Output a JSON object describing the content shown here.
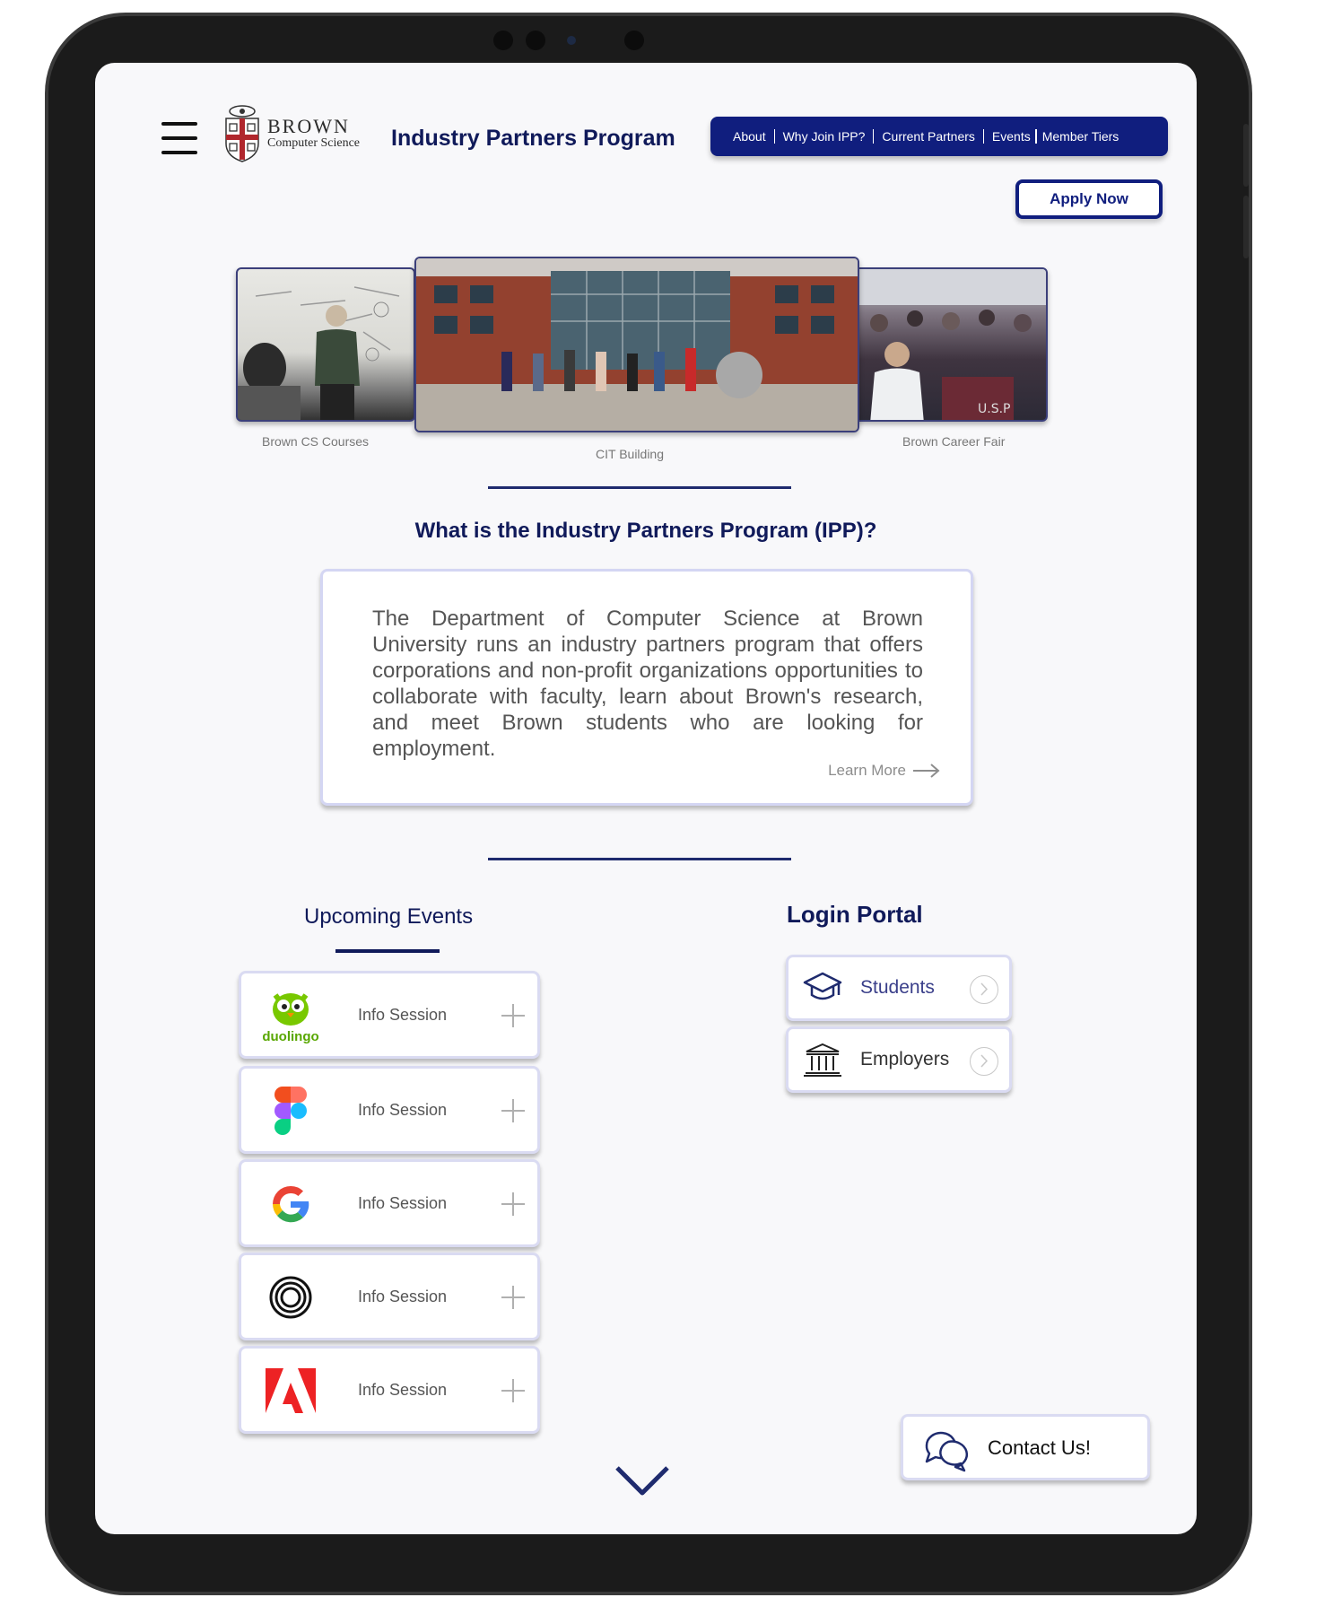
{
  "header": {
    "logo_primary": "BROWN",
    "logo_secondary": "Computer Science",
    "title": "Industry Partners Program"
  },
  "nav": {
    "items": [
      "About",
      "Why Join IPP?",
      "Current Partners",
      "Events",
      "Member Tiers"
    ]
  },
  "apply_label": "Apply Now",
  "carousel": {
    "captions": [
      "Brown CS Courses",
      "CIT Building",
      "Brown Career Fair"
    ]
  },
  "intro": {
    "question": "What is the Industry Partners Program (IPP)?",
    "body": "The Department of Computer Science at Brown University runs an industry partners program that offers corporations and non-profit organizations opportunities to collaborate with faculty, learn about Brown's research, and meet Brown students who are looking for employment.",
    "learn_more": "Learn More"
  },
  "events": {
    "title": "Upcoming Events",
    "items": [
      {
        "logo": "duolingo-logo",
        "logo_text": "duolingo",
        "label": "Info Session"
      },
      {
        "logo": "figma-logo",
        "label": "Info Session"
      },
      {
        "logo": "google-logo",
        "label": "Info Session"
      },
      {
        "logo": "openai-style-logo",
        "label": "Info Session"
      },
      {
        "logo": "adobe-logo",
        "label": "Info Session"
      }
    ]
  },
  "login": {
    "title": "Login Portal",
    "students": "Students",
    "employers": "Employers"
  },
  "contact": {
    "label": "Contact Us!"
  },
  "colors": {
    "brand_navy": "#101e7e",
    "title_navy": "#101a5a",
    "card_border": "#dadbf2"
  }
}
